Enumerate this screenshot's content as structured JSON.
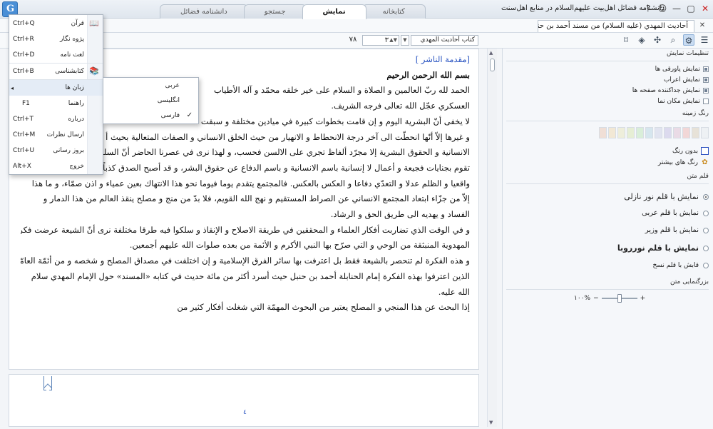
{
  "window": {
    "title": "دانشنامه فضائل اهل‌بیت علیهم‌السلام در منابع اهل‌سنت",
    "controls": [
      "?",
      "☺",
      "—",
      "▢",
      "✕"
    ]
  },
  "tabs": [
    {
      "label": "کتابخانه"
    },
    {
      "label": "نمایش"
    },
    {
      "label": "جستجو"
    },
    {
      "label": "دانشنامه فضائل"
    }
  ],
  "book_tab": {
    "label": "أحاديث المهدي (عليه السلام) من مسند أحمد بن حنبل",
    "close": "✕"
  },
  "toolbar": {
    "page_value": "۷۸",
    "volume_value": "۳",
    "book_select": "كتاب أحاديث المهدي"
  },
  "menu": {
    "items": [
      {
        "label": "قرآن",
        "shortcut": "Ctrl+Q",
        "icon": "quran-icon",
        "glyph": "📖"
      },
      {
        "label": "پژوه نگار",
        "shortcut": "Ctrl+R",
        "icon": "notes-icon",
        "glyph": ""
      },
      {
        "label": "لغت نامه",
        "shortcut": "Ctrl+D",
        "icon": "dictionary-icon",
        "glyph": ""
      },
      {
        "label": "کتابشناسی",
        "shortcut": "Ctrl+B",
        "icon": "bibliography-icon",
        "glyph": "📚"
      },
      {
        "label": "زبان ها",
        "shortcut": "",
        "icon": "languages-icon",
        "glyph": ""
      },
      {
        "label": "راهنما",
        "shortcut": "F1",
        "icon": "help-icon",
        "glyph": ""
      },
      {
        "label": "درباره",
        "shortcut": "Ctrl+T",
        "icon": "about-icon",
        "glyph": ""
      },
      {
        "label": "ارسال نظرات",
        "shortcut": "Ctrl+M",
        "icon": "feedback-icon",
        "glyph": ""
      },
      {
        "label": "بروز رسانی",
        "shortcut": "Ctrl+U",
        "icon": "update-icon",
        "glyph": ""
      },
      {
        "label": "خروج",
        "shortcut": "Alt+X",
        "icon": "exit-icon",
        "glyph": ""
      }
    ],
    "languages": [
      {
        "label": "عربی",
        "checked": false
      },
      {
        "label": "انگلیسی",
        "checked": false
      },
      {
        "label": "فارسی",
        "checked": true
      }
    ],
    "check_glyph": "✓",
    "submenu_arrow": "◂"
  },
  "document": {
    "heading": "[مقدمة الناشر ]",
    "bismillah": "بسم الله الرحمن الرحيم",
    "lines": [
      "الحمد لله ربّ العالمين و الصلاة و السلام على خير خلقه محمّد و آله الأطياب",
      "العسكري عجّل الله تعالى فرجه الشريف.",
      "لا يخفى أنّ البشرية اليوم و إن قامت بخطوات كبيرة في ميادين مختلفة و سبقت",
      "و غيرها إلاّ أنّها انحطّت الى آخر درجة الانحطاط و الانهيار من حيث الخلق الانساني و الصفات المتعالية بحيث أ",
      "الانسانية و الحقوق البشرية إلا مجرّد ألفاظ تجري على الالسن فحسب، و لهذا نرى في عصرنا الحاضر أنّ السلطا",
      "تقوم بجنايات فجيعة و أعمال لا إنسانية باسم الانسانية و باسم الدفاع عن حقوق البشر، و قد أصبح الصدق كذباً و الأمر الخيالي أمرا",
      "واقعيا و الظلم عدلا و التعدّي دفاعا و العكس بالعكس. فالمجتمع يتقدم يوما فيوما نحو هذا الانتهاك بعين عمياء و اذن صمّاء، و ما هذا",
      "إلاّ من جزّاء ابتعاد المجتمع الانساني عن الصراط المستقيم و نهج الله القويم، فلا بدّ من منج و مصلح ينقذ العالم من هذا الدمار و",
      "الفساد و يهديه الى طريق الحق و الرشاد.",
      "و في الوقت الذي تضاربت أفكار العلماء و المحققين في طريقة الاصلاح و الإنقاذ و سلكوا فيه طرقا مختلفة نرى أنّ الشيعة عرضت فكرة",
      "المهدوية المنبثقة من الوحي و التي صرّح بها النبي الأكرم و الأئمة من بعده صلوات الله عليهم أجمعين.",
      "و هذه الفكرة لم تنحصر بالشيعة فقط بل اعترفت بها سائر الفرق الإسلامية و إن اختلفت في مصداق المصلح و شخصه و من أئمّة العامّة",
      "الذين اعترفوا بهذه الفكرة إمام الحنابلة أحمد بن حنبل حيث أسرد أكثر من مائة حديث في كتابه «المسند» حول الإمام المهدي سلام",
      "الله عليه.",
      "إذا البحث عن هذا المنجي و المصلح يعتبر من البحوث المهمّة التي شغلت أفكار كثير من"
    ],
    "footer_page": "٤"
  },
  "settings": {
    "display_title": "تنظیمات نمایش",
    "display_options": [
      {
        "label": "نمایش پاورقی ها",
        "checked": true
      },
      {
        "label": "نمایش اعراب",
        "checked": true
      },
      {
        "label": "نمایش جداکننده صفحه ها",
        "checked": true
      },
      {
        "label": "نمایش مکان نما",
        "checked": false
      }
    ],
    "bg_title": "رنگ زمینه",
    "swatches": [
      "#eef1f4",
      "#e7e2d8",
      "#f2d7d7",
      "#eadbe6",
      "#dcdaee",
      "#e1e4f0",
      "#d6e6ee",
      "#d9eed9",
      "#e6eed5",
      "#eeeedb",
      "#f2e8d5",
      "#f0dfd6"
    ],
    "no_color": "بدون رنگ",
    "more_colors": "رنگ های بیشتر",
    "font_title": "قلم متن",
    "fonts": [
      {
        "label": "نمایش با قلم نور نازلی",
        "checked": true
      },
      {
        "label": "نمایش با قلم عربی",
        "checked": false
      },
      {
        "label": "نمایش با قلم وزیر",
        "checked": false
      },
      {
        "label": "نمایش با قلم نورروبا",
        "checked": false
      },
      {
        "label": "قابش با قلم نسخ",
        "checked": false
      }
    ],
    "zoom_title": "بزرگنمایی متن",
    "zoom_value": "۱۰۰%",
    "zoom_fraction": 0.5,
    "zoom_minus": "−",
    "zoom_plus": "+"
  }
}
